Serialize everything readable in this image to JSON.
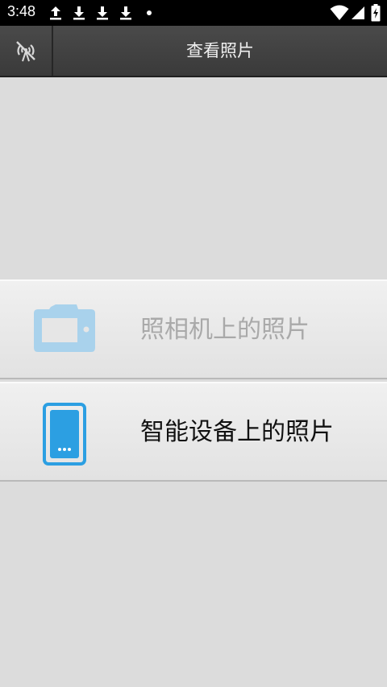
{
  "status_bar": {
    "time": "3:48",
    "notification_icons": [
      "upload-icon",
      "download-icon",
      "download-icon",
      "download-icon",
      "more-notifications-dot"
    ],
    "system_icons": [
      "wifi-icon",
      "cell-signal-icon",
      "battery-charging-icon"
    ]
  },
  "title_bar": {
    "title": "查看照片",
    "left_button_icon": "wifi-off-icon"
  },
  "menu": {
    "items": [
      {
        "label": "照相机上的照片",
        "icon": "camera-icon",
        "enabled": false
      },
      {
        "label": "智能设备上的照片",
        "icon": "smartphone-icon",
        "enabled": true
      }
    ]
  },
  "colors": {
    "icon_blue": "#2c9fe2",
    "icon_blue_disabled": "#a9d2ec",
    "title_bar": "#404040",
    "background": "#dcdcdc"
  }
}
